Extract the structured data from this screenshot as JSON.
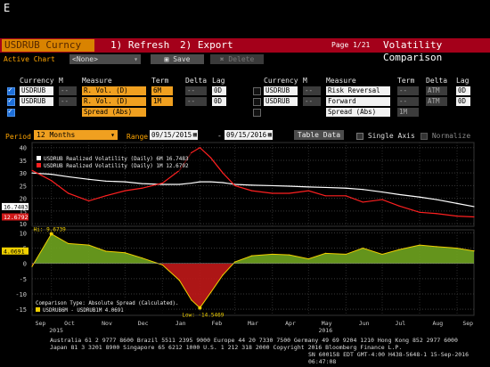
{
  "command": "E",
  "titlebar": {
    "ticker": "USDRUB Curncy",
    "refresh": "1) Refresh",
    "export": "2) Export",
    "page": "Page 1/21",
    "title": "Volatility Comparison"
  },
  "toolbar": {
    "active_chart_label": "Active Chart",
    "active_chart_value": "<None>",
    "save": "Save",
    "delete": "Delete"
  },
  "table": {
    "headers": [
      "Currency",
      "M",
      "Measure",
      "Term",
      "Delta",
      "Lag"
    ],
    "left_rows": [
      {
        "checked": true,
        "currency": "USDRUB",
        "m": "--",
        "measure": "R. Vol. (D)",
        "term": "6M",
        "delta": "--",
        "lag": "0D"
      },
      {
        "checked": true,
        "currency": "USDRUB",
        "m": "--",
        "measure": "R. Vol. (D)",
        "term": "1M",
        "delta": "--",
        "lag": "0D"
      },
      {
        "checked": true,
        "currency": "",
        "m": "",
        "measure": "Spread (Abs)",
        "term": "",
        "delta": "",
        "lag": ""
      }
    ],
    "right_rows": [
      {
        "checked": false,
        "currency": "USDRUB",
        "m": "--",
        "measure": "Risk Reversal",
        "term": "--",
        "delta": "ATM",
        "lag": "0D"
      },
      {
        "checked": false,
        "currency": "USDRUB",
        "m": "--",
        "measure": "Forward",
        "term": "--",
        "delta": "ATM",
        "lag": "0D"
      },
      {
        "checked": false,
        "currency": "",
        "m": "",
        "measure": "Spread (Abs)",
        "term": "1M",
        "delta": "",
        "lag": ""
      }
    ]
  },
  "period": {
    "label": "Period",
    "value": "12 Months",
    "range_label": "Range",
    "start": "09/15/2015",
    "separator": "-",
    "end": "09/15/2016",
    "table_data": "Table Data",
    "single_axis": "Single Axis",
    "normalize": "Normalize"
  },
  "colors": {
    "accent": "#f0a020",
    "titlebar": "#a4001a",
    "series_6m": "#ffffff",
    "series_1m": "#ff2020",
    "spread_pos": "#6fa41f",
    "spread_neg": "#c01818"
  },
  "chart_data": [
    {
      "type": "line",
      "legend": [
        "USDRUB Realized Volatility (Daily) 6M 16.7483",
        "USDRUB Realized Volatility (Daily) 1M 12.6792"
      ],
      "y_ticks": [
        40,
        35,
        30,
        25,
        20,
        15,
        10
      ],
      "ylim": [
        9,
        42
      ],
      "grid": true,
      "last_labels": [
        "16.7483",
        "12.6792"
      ],
      "x": [
        "2015-09-15",
        "2015-10-01",
        "2015-10-15",
        "2015-11-01",
        "2015-11-15",
        "2015-12-01",
        "2015-12-15",
        "2016-01-01",
        "2016-01-15",
        "2016-01-25",
        "2016-02-01",
        "2016-02-10",
        "2016-02-20",
        "2016-03-01",
        "2016-03-15",
        "2016-04-01",
        "2016-04-15",
        "2016-05-01",
        "2016-05-15",
        "2016-06-01",
        "2016-06-15",
        "2016-07-01",
        "2016-07-15",
        "2016-08-01",
        "2016-08-15",
        "2016-09-01",
        "2016-09-15"
      ],
      "series": [
        {
          "name": "USDRUB Realized Volatility (Daily) 6M",
          "values": [
            30,
            29.5,
            28.5,
            27.5,
            26.8,
            26.5,
            25.8,
            25.5,
            25.5,
            26,
            26.5,
            26.5,
            26.2,
            25.5,
            25.2,
            25,
            24.8,
            24.5,
            24.3,
            24,
            23.5,
            22.5,
            21.5,
            20.5,
            19.5,
            18,
            16.7483
          ]
        },
        {
          "name": "USDRUB Realized Volatility (Daily) 1M",
          "values": [
            31,
            27,
            22,
            19,
            21,
            23,
            24,
            26,
            31,
            38,
            40,
            36,
            30,
            25,
            23,
            22,
            22,
            23,
            21,
            21,
            18.5,
            19.5,
            17,
            14.5,
            14,
            13,
            12.6792
          ]
        }
      ]
    },
    {
      "type": "area",
      "legend": [
        "Comparison Type: Absolute Spread (Calculated).",
        "USDRUB6M - USDRUB1M 4.0691"
      ],
      "y_ticks": [
        10,
        5,
        0,
        -5,
        -10,
        -15
      ],
      "ylim": [
        -17,
        11
      ],
      "annotations": [
        "Hi: 9.6739",
        "Low: -14.5469"
      ],
      "last_label": "4.0691",
      "x": [
        "2015-09-15",
        "2015-10-01",
        "2015-10-15",
        "2015-11-01",
        "2015-11-15",
        "2015-12-01",
        "2015-12-15",
        "2016-01-01",
        "2016-01-15",
        "2016-01-25",
        "2016-02-01",
        "2016-02-10",
        "2016-02-20",
        "2016-03-01",
        "2016-03-15",
        "2016-04-01",
        "2016-04-15",
        "2016-05-01",
        "2016-05-15",
        "2016-06-01",
        "2016-06-15",
        "2016-07-01",
        "2016-07-15",
        "2016-08-01",
        "2016-08-15",
        "2016-09-01",
        "2016-09-15"
      ],
      "values": [
        -1,
        9.6739,
        6.5,
        6,
        4,
        3.5,
        1.8,
        -0.5,
        -5.5,
        -12,
        -14.5469,
        -9.5,
        -3.8,
        0.5,
        2.5,
        3,
        2.8,
        1.5,
        3.3,
        3,
        5,
        3,
        4.5,
        6,
        5.5,
        5,
        4.0691
      ],
      "x_month_labels": [
        "Sep",
        "Oct",
        "Nov",
        "Dec",
        "Jan",
        "Feb",
        "Mar",
        "Apr",
        "May",
        "Jun",
        "Jul",
        "Aug",
        "Sep"
      ],
      "x_year_labels": [
        "2015",
        "2016"
      ]
    }
  ],
  "footer": {
    "line1": "Australia 61 2 9777 8600 Brazil 5511 2395 9000 Europe 44 20 7330 7500 Germany 49 69 9204 1210 Hong Kong 852 2977 6000",
    "line2": "Japan 81 3 3201 8900        Singapore 65 6212 1000        U.S. 1 212 318 2000        Copyright 2016 Bloomberg Finance L.P.",
    "line3": "SN 600158 EDT  GMT-4:00 H438-5648-1 15-Sep-2016 06:47:08"
  }
}
